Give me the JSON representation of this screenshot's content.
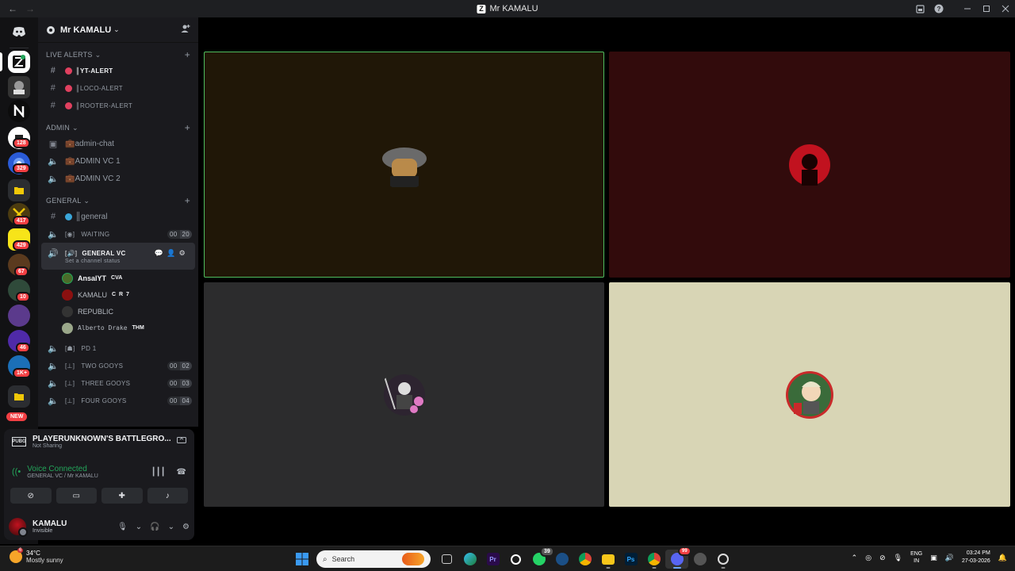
{
  "window": {
    "title": "Mr KAMALU",
    "back_arrow": "←",
    "forward_arrow": "→",
    "app_logo_letter": "Z"
  },
  "server_rail": {
    "items": [
      {
        "name": "discord-home",
        "badge": ""
      },
      {
        "name": "server-active",
        "badge": ""
      },
      {
        "name": "server-2",
        "badge": ""
      },
      {
        "name": "server-3",
        "badge": ""
      },
      {
        "name": "server-4",
        "badge": "128"
      },
      {
        "name": "server-5",
        "badge": "329"
      },
      {
        "name": "folder-1",
        "badge": "417"
      },
      {
        "name": "server-6",
        "badge": "429"
      },
      {
        "name": "server-7",
        "badge": "67"
      },
      {
        "name": "server-8",
        "badge": "10"
      },
      {
        "name": "server-9",
        "badge": ""
      },
      {
        "name": "server-10",
        "badge": "46"
      },
      {
        "name": "server-11",
        "badge": "1K+"
      },
      {
        "name": "folder-2",
        "badge": ""
      }
    ],
    "new_label": "NEW"
  },
  "server": {
    "name": "Mr KAMALU"
  },
  "categories": {
    "live_alerts": "LIVE ALERTS",
    "admin": "ADMIN",
    "general": "GENERAL"
  },
  "channels": {
    "yt_alert": "║YT-ALERT",
    "loco_alert": "║LOCO-ALERT",
    "rooter_alert": "║ROOTER-ALERT",
    "admin_chat": "💼admin-chat",
    "admin_vc1": "💼ADMIN VC 1",
    "admin_vc2": "💼ADMIN VC 2",
    "general": "║general",
    "waiting": "WAITING",
    "waiting_counts": [
      "00",
      "20"
    ],
    "general_vc": "GENERAL VC",
    "general_vc_status": "Set a channel status",
    "pd1": "PD 1",
    "two_gooys": "TWO GOOYS",
    "two_gooys_counts": [
      "00",
      "02"
    ],
    "three_gooys": "THREE GOOYS",
    "three_gooys_counts": [
      "00",
      "03"
    ],
    "four_gooys": "FOUR GOOYS",
    "four_gooys_counts": [
      "00",
      "04"
    ]
  },
  "voice_users": [
    {
      "name": "AnsalYT",
      "tag": "CVA"
    },
    {
      "name": "KAMALU",
      "tag": "C R 7"
    },
    {
      "name": "REPUBLIC",
      "tag": ""
    },
    {
      "name": "Alberto Drake",
      "tag": "THM"
    }
  ],
  "activity": {
    "game_icon": "PUBG",
    "game_title": "PLAYERUNKNOWN'S BATTLEGRO...",
    "game_status": "Not Sharing",
    "voice_status": "Voice Connected",
    "voice_location": "GENERAL VC / Mr KAMALU"
  },
  "account": {
    "name": "KAMALU",
    "status": "Invisible"
  },
  "taskbar": {
    "weather_temp": "34°C",
    "weather_desc": "Mostly sunny",
    "weather_badge": "6",
    "search_placeholder": "Search",
    "whatsapp_badge": "39",
    "discord_badge": "99",
    "lang_top": "ENG",
    "lang_bottom": "IN",
    "time": "03:24 PM",
    "date": "27-03-2026"
  },
  "colors": {
    "tile1": "#201707",
    "tile2": "#320b0c",
    "tile3": "#2c2c2d",
    "tile4": "#d8d5b5",
    "speaking_border": "#4fbd5e"
  }
}
